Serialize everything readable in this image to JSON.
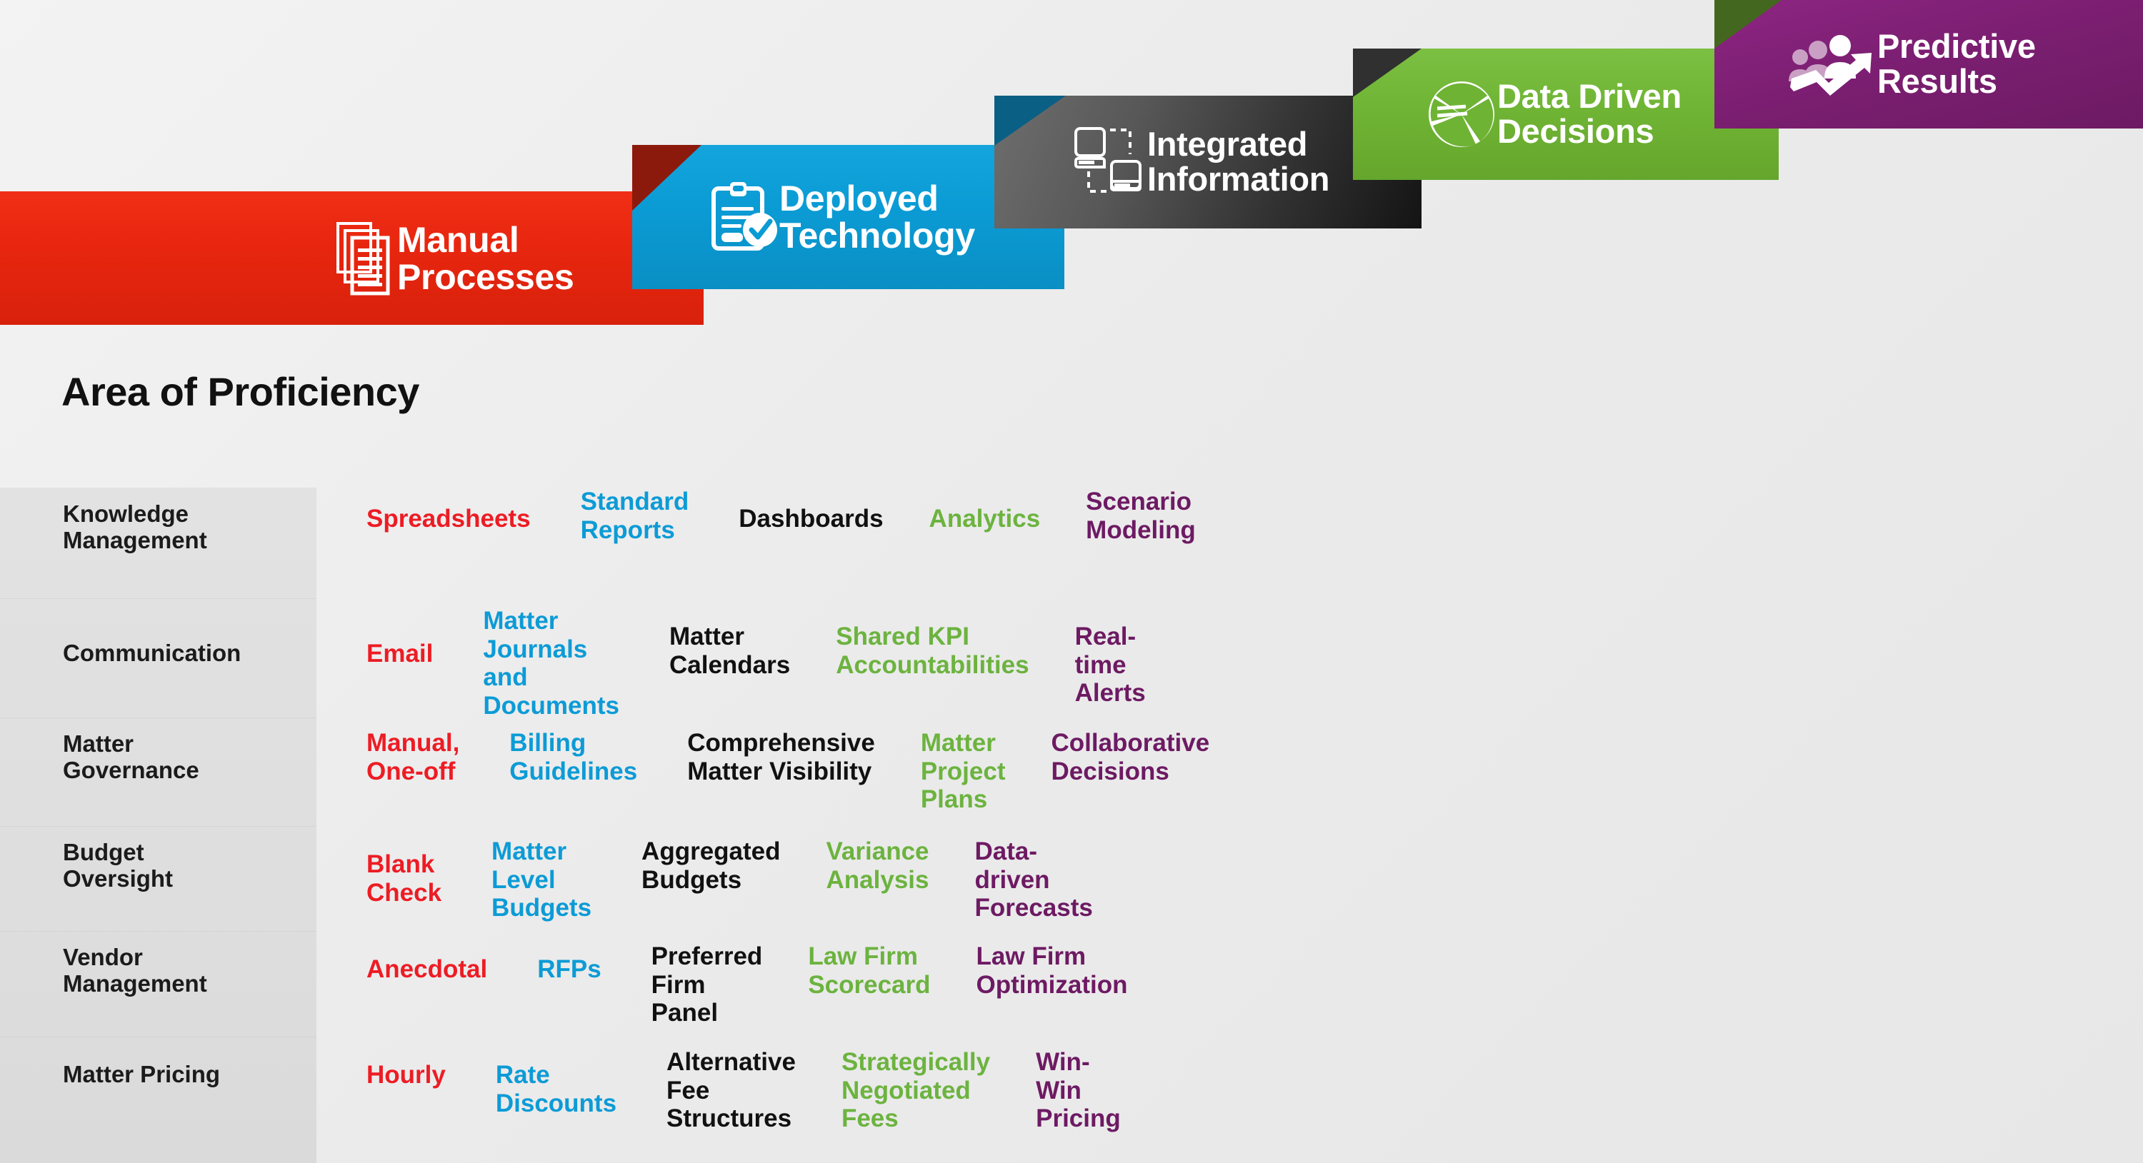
{
  "heading": "Area of Proficiency",
  "colors": {
    "manual": "#ed1c24",
    "deployed": "#0c9bd6",
    "integrated": "#111111",
    "data": "#6cb33f",
    "predictive": "#6d1a63",
    "label_band": "#e0e0e0",
    "page_background": "#ededed"
  },
  "banners": [
    {
      "key": "manual",
      "label": "Manual\nProcesses",
      "icon": "stacked-documents-icon",
      "color": "#e8260f",
      "fold_color": "none"
    },
    {
      "key": "deployed",
      "label": "Deployed\nTechnology",
      "icon": "clipboard-check-icon",
      "color": "#0b9bd4",
      "fold_color": "#8c1a0c"
    },
    {
      "key": "integrated",
      "label": "Integrated\nInformation",
      "icon": "networked-computers-icon",
      "color": "#333333",
      "fold_color": "#0a5f85"
    },
    {
      "key": "data",
      "label": "Data Driven\nDecisions",
      "icon": "pie-chart-icon",
      "color": "#6fb334",
      "fold_color": "#303030"
    },
    {
      "key": "predictive",
      "label": "Predictive\nResults",
      "icon": "people-growth-arrow-icon",
      "color": "#7d1f73",
      "fold_color": "#44671f"
    }
  ],
  "matrix": {
    "columns": [
      "Area of Proficiency",
      "Manual Processes",
      "Deployed Technology",
      "Integrated Information",
      "Data Driven Decisions",
      "Predictive Results"
    ],
    "rows": [
      {
        "label": "Knowledge\nManagement",
        "manual": "Spreadsheets",
        "deployed": "Standard\nReports",
        "integrated": "Dashboards",
        "data": "Analytics",
        "predictive": "Scenario\nModeling"
      },
      {
        "label": "Communication",
        "manual": "Email",
        "deployed": "Matter Journals\nand\nDocuments",
        "integrated": "Matter\nCalendars",
        "data": "Shared KPI\nAccountabilities",
        "predictive": "Real-time\nAlerts"
      },
      {
        "label": "Matter\nGovernance",
        "manual": "Manual,\nOne-off",
        "deployed": "Billing\nGuidelines",
        "integrated": "Comprehensive\nMatter Visibility",
        "data": "Matter Project\nPlans",
        "predictive": "Collaborative\nDecisions"
      },
      {
        "label": "Budget\nOversight",
        "manual": "Blank Check",
        "deployed": "Matter Level\nBudgets",
        "integrated": "Aggregated\nBudgets",
        "data": "Variance\nAnalysis",
        "predictive": "Data-driven\nForecasts"
      },
      {
        "label": "Vendor\nManagement",
        "manual": "Anecdotal",
        "deployed": "RFPs",
        "integrated": "Preferred Firm\nPanel",
        "data": "Law Firm\nScorecard",
        "predictive": "Law Firm\nOptimization"
      },
      {
        "label": "Matter Pricing",
        "manual": "Hourly",
        "deployed": "Rate Discounts",
        "integrated": "Alternative Fee\nStructures",
        "data": "Strategically\nNegotiated Fees",
        "predictive": "Win-Win\nPricing"
      }
    ]
  }
}
